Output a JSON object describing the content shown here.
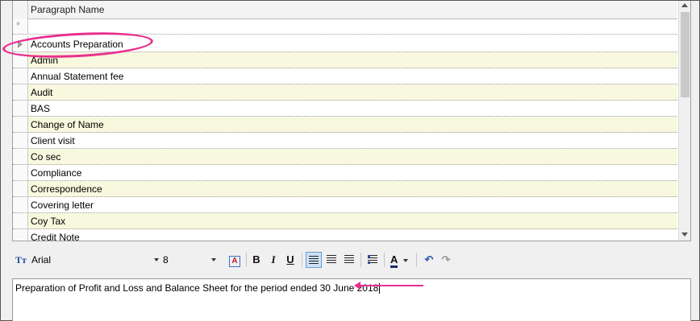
{
  "grid": {
    "column_header": "Paragraph Name",
    "new_row_marker": "*",
    "rows": [
      {
        "name": "Accounts Preparation"
      },
      {
        "name": "Admin"
      },
      {
        "name": "Annual Statement fee"
      },
      {
        "name": "Audit"
      },
      {
        "name": "BAS"
      },
      {
        "name": "Change of Name"
      },
      {
        "name": "Client visit"
      },
      {
        "name": "Co sec"
      },
      {
        "name": "Compliance"
      },
      {
        "name": "Correspondence"
      },
      {
        "name": "Covering letter"
      },
      {
        "name": "Coy Tax"
      },
      {
        "name": "Credit Note"
      }
    ]
  },
  "toolbar": {
    "font_icon": "Tт",
    "font_name": "Arial",
    "font_size": "8",
    "bold_label": "B",
    "italic_label": "I",
    "underline_label": "U",
    "font_color_label": "A",
    "undo_symbol": "↶",
    "redo_symbol": "↷"
  },
  "editor": {
    "text": "Preparation of Profit and Loss and Balance Sheet for the period ended 30 June 2018"
  },
  "colors": {
    "alt_row": "#f7f8dd",
    "annotation": "#e8308e",
    "active_button": "#cce0f7"
  }
}
